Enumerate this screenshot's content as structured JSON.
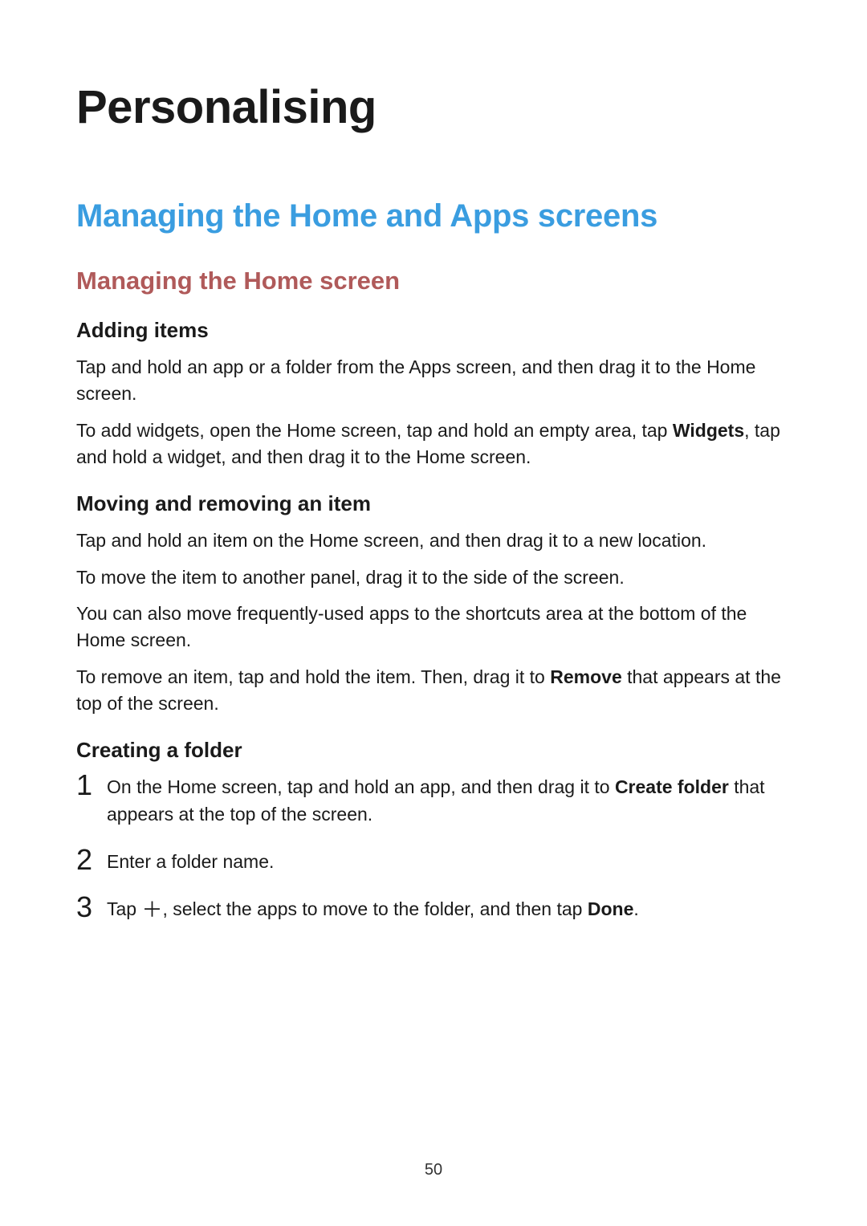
{
  "page": {
    "title": "Personalising",
    "section_title": "Managing the Home and Apps screens",
    "subsection_title": "Managing the Home screen",
    "number": "50"
  },
  "adding_items": {
    "heading": "Adding items",
    "para1": "Tap and hold an app or a folder from the Apps screen, and then drag it to the Home screen.",
    "para2_pre": "To add widgets, open the Home screen, tap and hold an empty area, tap ",
    "para2_bold": "Widgets",
    "para2_post": ", tap and hold a widget, and then drag it to the Home screen."
  },
  "moving_removing": {
    "heading": "Moving and removing an item",
    "para1": "Tap and hold an item on the Home screen, and then drag it to a new location.",
    "para2": "To move the item to another panel, drag it to the side of the screen.",
    "para3": "You can also move frequently-used apps to the shortcuts area at the bottom of the Home screen.",
    "para4_pre": "To remove an item, tap and hold the item. Then, drag it to ",
    "para4_bold": "Remove",
    "para4_post": " that appears at the top of the screen."
  },
  "creating_folder": {
    "heading": "Creating a folder",
    "steps": {
      "n1": "1",
      "s1_pre": "On the Home screen, tap and hold an app, and then drag it to ",
      "s1_bold": "Create folder",
      "s1_post": " that appears at the top of the screen.",
      "n2": "2",
      "s2": "Enter a folder name.",
      "n3": "3",
      "s3_pre": "Tap ",
      "s3_post": ", select the apps to move to the folder, and then tap ",
      "s3_bold": "Done",
      "s3_end": "."
    }
  }
}
